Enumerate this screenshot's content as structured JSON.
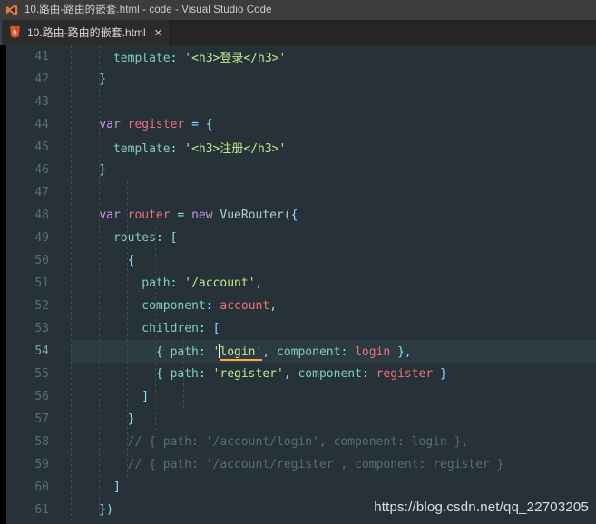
{
  "window": {
    "title": "10.路由-路由的嵌套.html - code - Visual Studio Code",
    "app_icon": "vscode-logo-icon"
  },
  "tabs": [
    {
      "label": "10.路由-路由的嵌套.html",
      "icon": "html5-file-icon",
      "close_label": "✕",
      "active": true
    }
  ],
  "editor": {
    "language": "html",
    "theme_background": "#263238",
    "active_line": 54,
    "lines": [
      {
        "number": "41"
      },
      {
        "number": "42"
      },
      {
        "number": "43"
      },
      {
        "number": "44"
      },
      {
        "number": "45"
      },
      {
        "number": "46"
      },
      {
        "number": "47"
      },
      {
        "number": "48"
      },
      {
        "number": "49"
      },
      {
        "number": "50"
      },
      {
        "number": "51"
      },
      {
        "number": "52"
      },
      {
        "number": "53"
      },
      {
        "number": "54"
      },
      {
        "number": "55"
      },
      {
        "number": "56"
      },
      {
        "number": "57"
      },
      {
        "number": "58"
      },
      {
        "number": "59"
      },
      {
        "number": "60"
      },
      {
        "number": "61"
      }
    ],
    "code": {
      "l41_indent": "      ",
      "l41_prop": "template",
      "l41_colon": ": ",
      "l41_str": "'<h3>登录</h3>'",
      "l42": "    }",
      "l44_indent": "    ",
      "l44_var": "var",
      "l44_name": " register ",
      "l44_eq": "= {",
      "l45_indent": "      ",
      "l45_prop": "template",
      "l45_colon": ": ",
      "l45_str": "'<h3>注册</h3>'",
      "l46": "    }",
      "l48_indent": "    ",
      "l48_var": "var",
      "l48_name": " router ",
      "l48_eq": "= ",
      "l48_new": "new",
      "l48_class": " VueRouter",
      "l48_open": "({",
      "l49_indent": "      ",
      "l49_prop": "routes",
      "l49_colon": ": ",
      "l49_bracket": "[",
      "l50": "        {",
      "l51_indent": "          ",
      "l51_prop": "path",
      "l51_colon": ": ",
      "l51_str": "'/account'",
      "l51_comma": ",",
      "l52_indent": "          ",
      "l52_prop": "component",
      "l52_colon": ": ",
      "l52_val": "account",
      "l52_comma": ",",
      "l53_indent": "          ",
      "l53_prop": "children",
      "l53_colon": ": ",
      "l53_bracket": "[",
      "l54_indent": "            ",
      "l54_brace": "{ ",
      "l54_prop": "path",
      "l54_colon": ": ",
      "l54_quote": "'",
      "l54_str": "login'",
      "l54_mid": ", ",
      "l54_prop2": "component",
      "l54_colon2": ": ",
      "l54_val": "login",
      "l54_end": " },",
      "l55_indent": "            ",
      "l55_brace": "{ ",
      "l55_prop": "path",
      "l55_colon": ": ",
      "l55_str": "'register'",
      "l55_mid": ", ",
      "l55_prop2": "component",
      "l55_colon2": ": ",
      "l55_val": "register",
      "l55_end": " }",
      "l56": "          ]",
      "l57": "        }",
      "l58": "        // { path: '/account/login', component: login },",
      "l59": "        // { path: '/account/register', component: register }",
      "l60": "      ]",
      "l61": "    })"
    }
  },
  "watermark": {
    "text": "https://blog.csdn.net/qq_22703205"
  }
}
